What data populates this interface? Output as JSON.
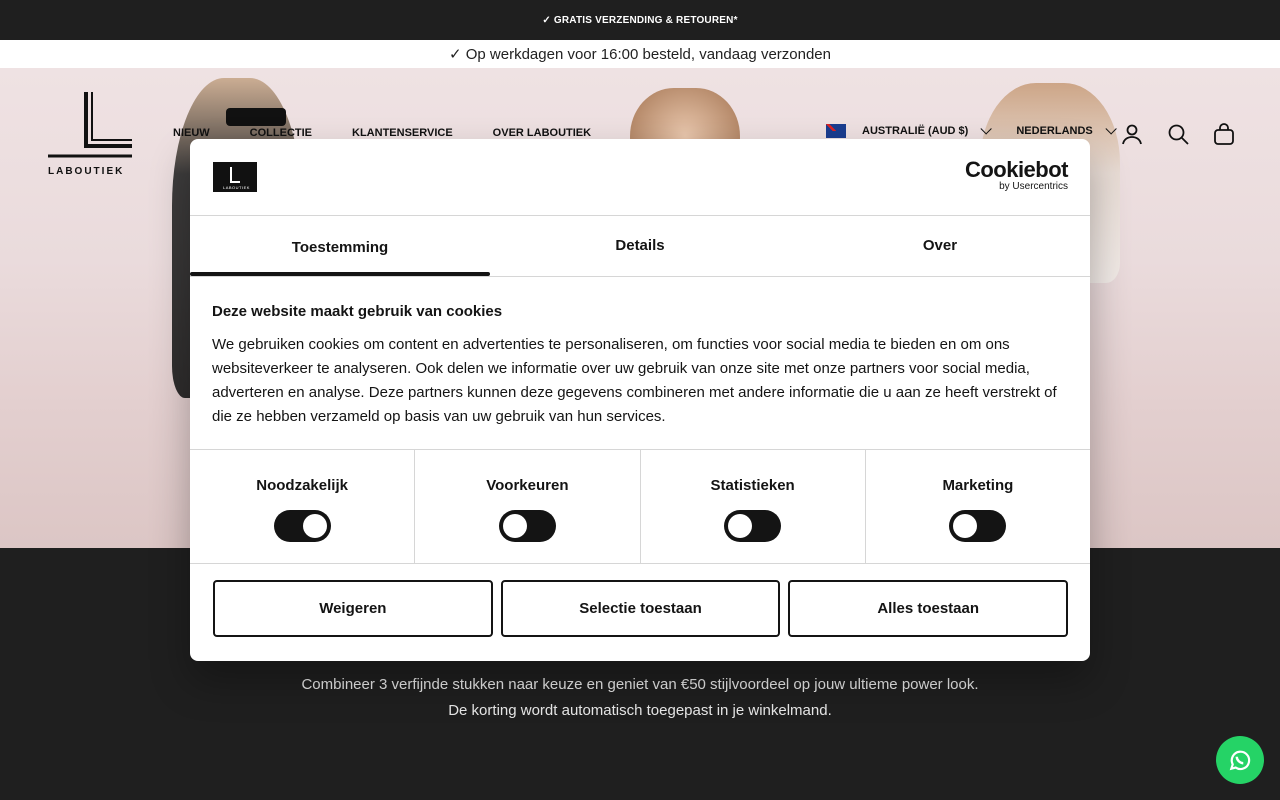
{
  "announcement": {
    "top": "✓ GRATIS VERZENDING & RETOUREN*",
    "sub": "✓ Op werkdagen voor 16:00 besteld, vandaag verzonden"
  },
  "header": {
    "logo_text": "LABOUTIEK",
    "nav": [
      "NIEUW",
      "COLLECTIE",
      "KLANTENSERVICE",
      "OVER LABOUTIEK"
    ],
    "country": "AUSTRALIË (AUD $)",
    "language": "NEDERLANDS",
    "icons": [
      "account-icon",
      "search-icon",
      "cart-icon"
    ]
  },
  "cookie_dialog": {
    "brand": "Cookiebot",
    "brand_sub": "by Usercentrics",
    "tabs": [
      "Toestemming",
      "Details",
      "Over"
    ],
    "active_tab": "Toestemming",
    "title": "Deze website maakt gebruik van cookies",
    "body": "We gebruiken cookies om content en advertenties te personaliseren, om functies voor social media te bieden en om ons websiteverkeer te analyseren. Ook delen we informatie over uw gebruik van onze site met onze partners voor social media, adverteren en analyse. Deze partners kunnen deze gegevens combineren met andere informatie die u aan ze heeft verstrekt of die ze hebben verzameld op basis van uw gebruik van hun services.",
    "toggles": [
      {
        "label": "Noodzakelijk",
        "state": "on"
      },
      {
        "label": "Voorkeuren",
        "state": "off"
      },
      {
        "label": "Statistieken",
        "state": "off"
      },
      {
        "label": "Marketing",
        "state": "off"
      }
    ],
    "buttons": {
      "deny": "Weigeren",
      "selection": "Selectie toestaan",
      "all": "Alles toestaan"
    }
  },
  "promo": {
    "line1": "Combineer 3 verfijnde stukken naar keuze en geniet van €50 stijlvoordeel op jouw ultieme power look.",
    "line2": "De korting wordt automatisch toegepast in je winkelmand."
  },
  "colors": {
    "dark": "#1f1f1f",
    "whatsapp": "#25d366"
  }
}
